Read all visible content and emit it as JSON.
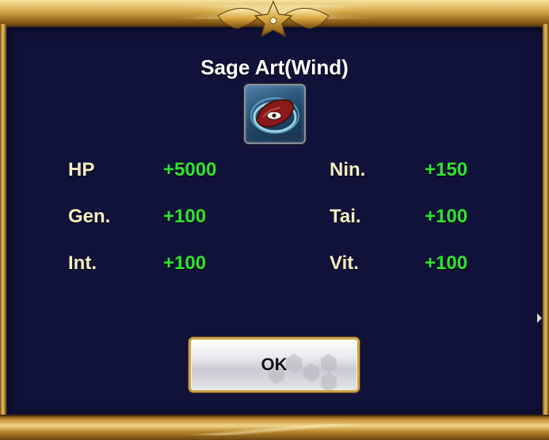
{
  "dialog": {
    "title": "Sage Art(Wind)",
    "icon": "wind-sage-art-icon"
  },
  "stats": [
    {
      "label": "HP",
      "value": "+5000"
    },
    {
      "label": "Nin.",
      "value": "+150"
    },
    {
      "label": "Gen.",
      "value": "+100"
    },
    {
      "label": "Tai.",
      "value": "+100"
    },
    {
      "label": "Int.",
      "value": "+100"
    },
    {
      "label": "Vit.",
      "value": "+100"
    }
  ],
  "ok_button": {
    "label": "OK"
  },
  "colors": {
    "panel": "#11123a",
    "frame_gold": "#c99a3b",
    "stat_label": "#f4eec0",
    "stat_value": "#2ee52e"
  }
}
